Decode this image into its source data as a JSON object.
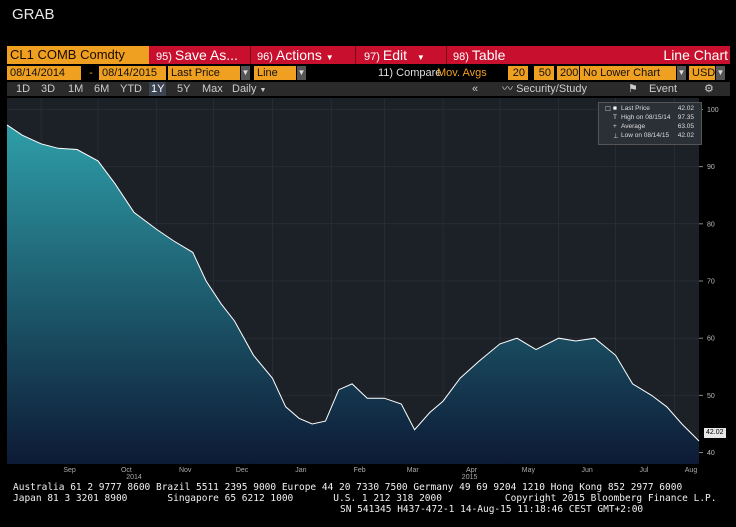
{
  "window": {
    "title": "GRAB"
  },
  "toolbar": {
    "ticker": "CL1 COMB Comdty",
    "save": {
      "num": "95)",
      "label": "Save As..."
    },
    "actions": {
      "num": "96)",
      "label": "Actions"
    },
    "edit": {
      "num": "97)",
      "label": "Edit"
    },
    "table": {
      "num": "98)",
      "label": "Table"
    },
    "chart_type": "Line Chart"
  },
  "settings": {
    "start_date": "08/14/2014",
    "dash": "-",
    "end_date": "08/14/2015",
    "field": "Last Price",
    "style": "Line",
    "compare_num": "11)",
    "compare_label": "Compare",
    "mov_avgs": "Mov. Avgs",
    "ma1": "20",
    "ma2": "50",
    "ma3": "200",
    "lower_chart": "No Lower Chart",
    "currency": "USD"
  },
  "ranges": {
    "items": [
      "1D",
      "3D",
      "1M",
      "6M",
      "YTD",
      "1Y",
      "5Y",
      "Max"
    ],
    "selected": "1Y",
    "frequency": "Daily",
    "collapse": "«",
    "security_study": "Security/Study",
    "event": "Event"
  },
  "legend": {
    "last_price_label": "Last Price",
    "last_price_value": "42.02",
    "high_label": "High on 08/15/14",
    "high_value": "97.35",
    "average_label": "Average",
    "average_value": "63.05",
    "low_label": "Low on 08/14/15",
    "low_value": "42.02"
  },
  "chart_data": {
    "type": "area",
    "series": [
      {
        "name": "Last Price",
        "x": [
          "2014-08-14",
          "2014-08-22",
          "2014-09-01",
          "2014-09-10",
          "2014-09-20",
          "2014-10-01",
          "2014-10-10",
          "2014-10-20",
          "2014-11-01",
          "2014-11-10",
          "2014-11-20",
          "2014-11-27",
          "2014-12-05",
          "2014-12-12",
          "2014-12-22",
          "2015-01-01",
          "2015-01-08",
          "2015-01-15",
          "2015-01-22",
          "2015-01-29",
          "2015-02-05",
          "2015-02-12",
          "2015-02-20",
          "2015-03-01",
          "2015-03-10",
          "2015-03-17",
          "2015-03-25",
          "2015-04-01",
          "2015-04-10",
          "2015-04-20",
          "2015-05-01",
          "2015-05-10",
          "2015-05-20",
          "2015-06-01",
          "2015-06-10",
          "2015-06-20",
          "2015-07-01",
          "2015-07-10",
          "2015-07-20",
          "2015-07-28",
          "2015-08-05",
          "2015-08-14"
        ],
        "values": [
          97.3,
          95.5,
          94,
          93.2,
          93,
          91,
          87,
          82,
          79,
          77,
          75,
          70,
          66,
          63,
          57,
          53,
          48,
          46,
          45,
          45.5,
          51,
          52,
          49.5,
          49.5,
          48.5,
          44,
          47,
          49,
          53,
          56,
          59,
          60,
          58,
          60,
          59.5,
          60,
          57,
          52,
          50,
          48,
          45,
          42.02
        ]
      }
    ],
    "y_ticks": [
      "100",
      "90",
      "80",
      "70",
      "60",
      "50",
      "40"
    ],
    "ylim": [
      38,
      102
    ],
    "x_ticks": [
      "Sep",
      "Oct",
      "Nov",
      "Dec",
      "Jan",
      "Feb",
      "Mar",
      "Apr",
      "May",
      "Jun",
      "Jul",
      "Aug"
    ],
    "year_labels": [
      "2014",
      "2015"
    ],
    "last_value_label": "42.02",
    "grid": true,
    "legend_position": "top-right",
    "colors": {
      "area_top": "#2e9ea8",
      "area_bottom": "#0d1a35",
      "line": "#ffffff",
      "background": "#1c2128"
    }
  },
  "footer": {
    "line1": "Australia 61 2 9777 8600 Brazil 5511 2395 9000 Europe 44 20 7330 7500 Germany 49 69 9204 1210 Hong Kong 852 2977 6000",
    "line2": "Japan 81 3 3201 8900       Singapore 65 6212 1000       U.S. 1 212 318 2000           Copyright 2015 Bloomberg Finance L.P.",
    "line3": "SN 541345 H437-472-1 14-Aug-15 11:18:46 CEST GMT+2:00"
  }
}
